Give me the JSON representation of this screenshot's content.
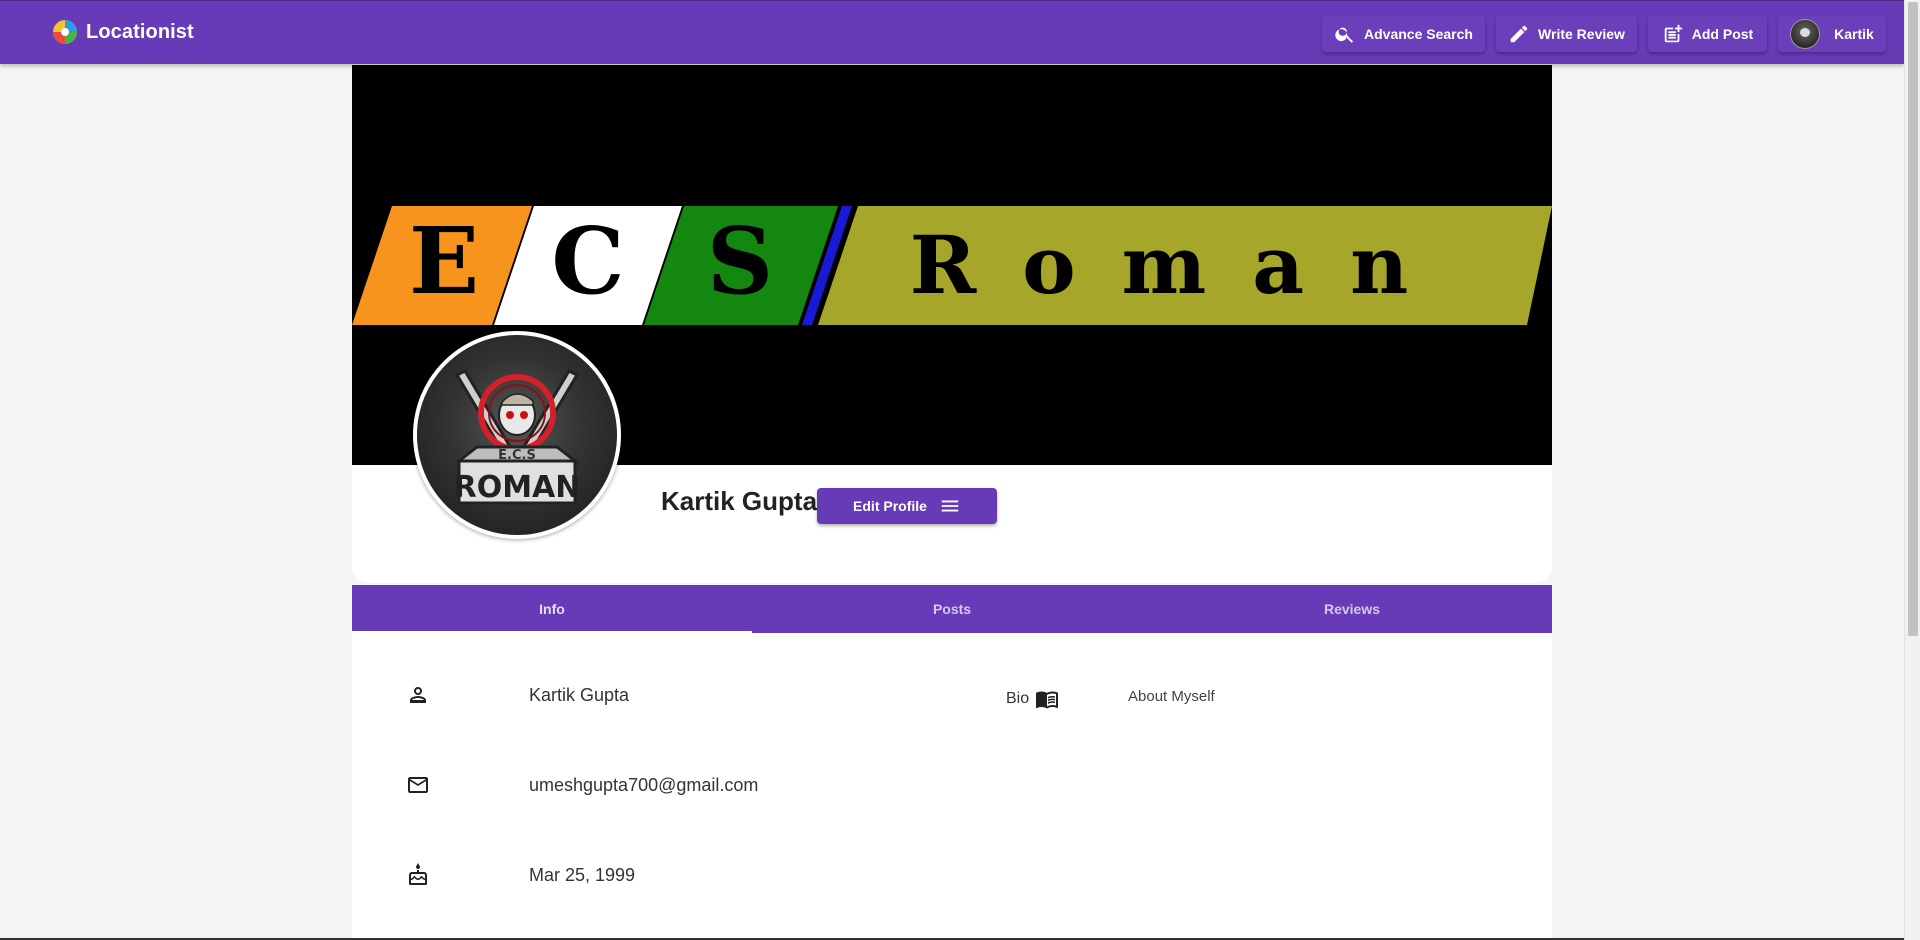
{
  "app": {
    "name": "Locationist"
  },
  "nav": {
    "advance_search": "Advance Search",
    "write_review": "Write Review",
    "add_post": "Add Post",
    "user": "Kartik"
  },
  "cover": {
    "banner_text": [
      "E",
      "C",
      "S",
      "Roman"
    ],
    "colors": {
      "orange": "#f7941d",
      "white": "#ffffff",
      "green": "#13870f",
      "blue": "#1a1ad6",
      "olive": "#a6a62a"
    }
  },
  "avatar": {
    "badge_top": "E.C.S",
    "badge_name": "ROMAN"
  },
  "profile": {
    "name": "Kartik Gupta",
    "edit_label": "Edit Profile"
  },
  "tabs": [
    {
      "label": "Info",
      "active": true
    },
    {
      "label": "Posts",
      "active": false
    },
    {
      "label": "Reviews",
      "active": false
    }
  ],
  "info": {
    "full_name": "Kartik Gupta",
    "email": "umeshgupta700@gmail.com",
    "birthday": "Mar 25, 1999",
    "bio_label": "Bio",
    "bio_value": "About Myself"
  },
  "theme": {
    "primary": "#673ab7"
  }
}
